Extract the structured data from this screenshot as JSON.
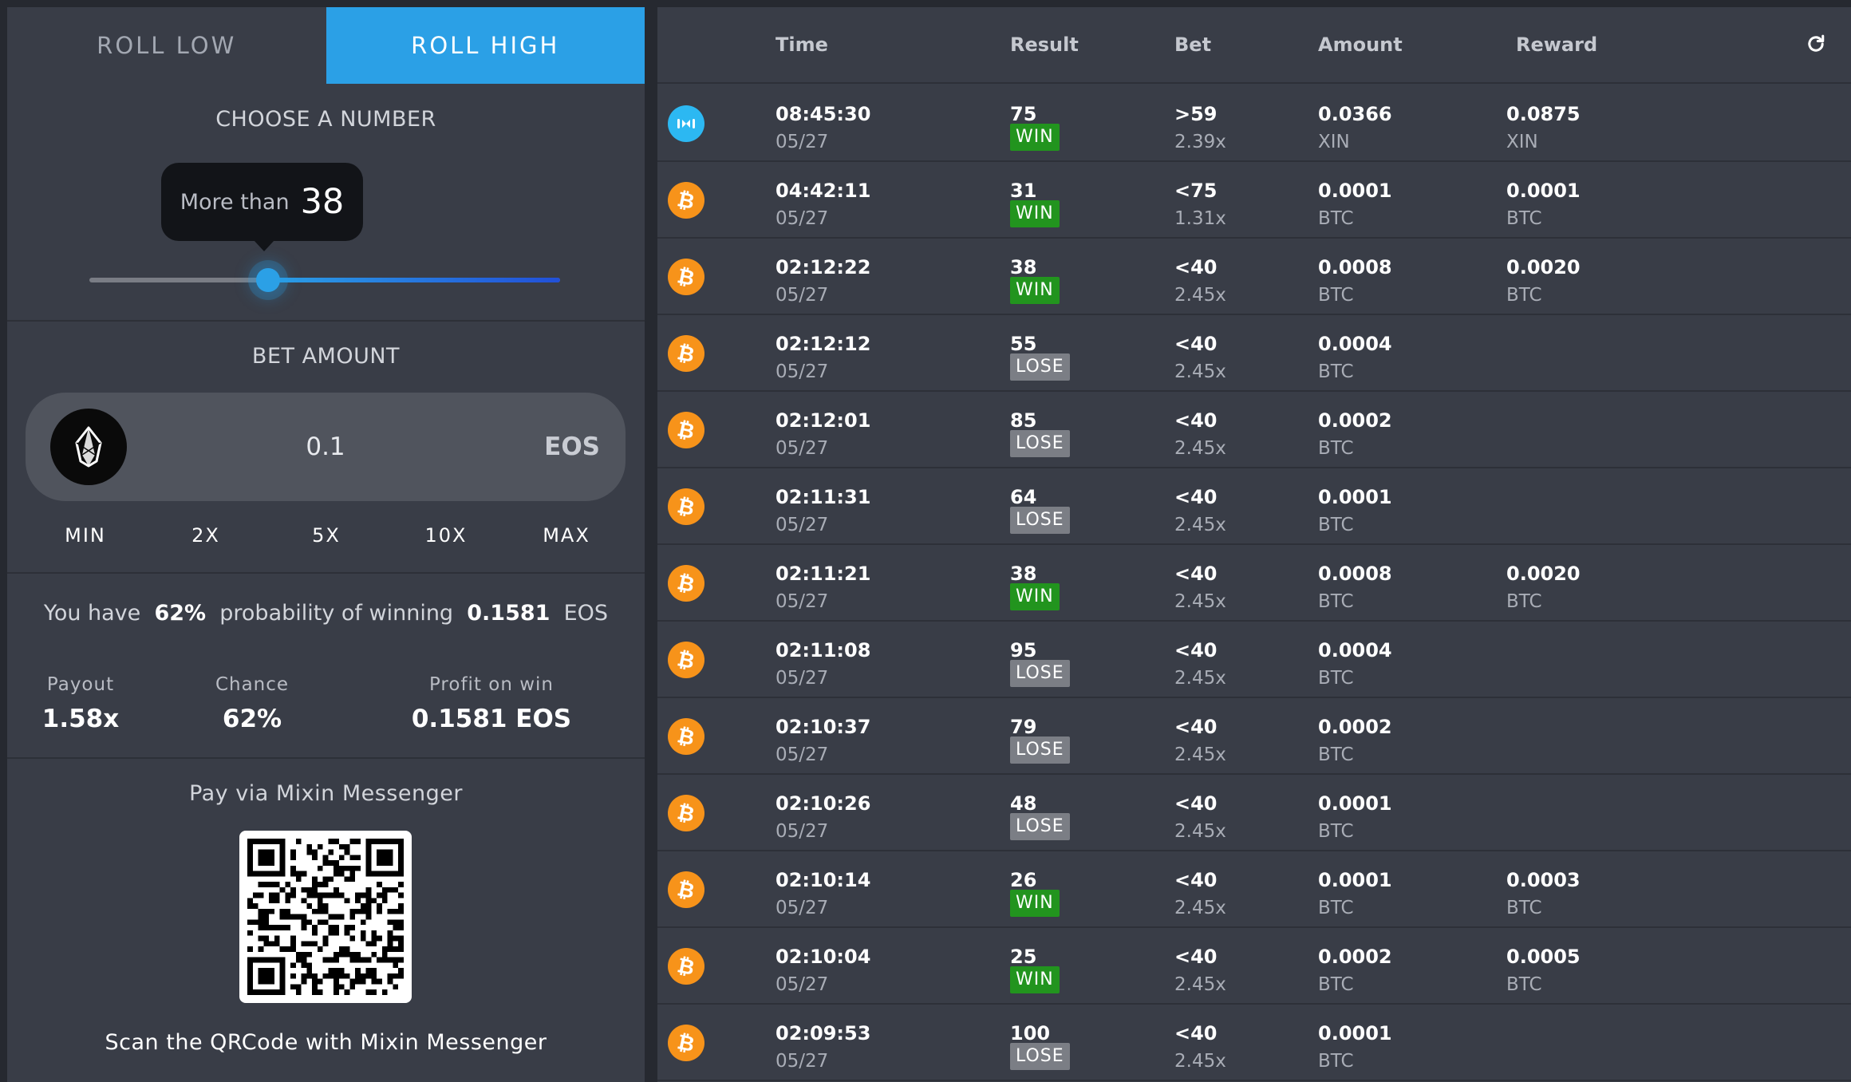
{
  "tabs": [
    {
      "label": "ROLL LOW",
      "active": false
    },
    {
      "label": "ROLL HIGH",
      "active": true
    }
  ],
  "chooser": {
    "heading": "CHOOSE A NUMBER",
    "tooltip_label": "More than",
    "tooltip_value": "38",
    "slider_value": 38,
    "slider_min": 0,
    "slider_max": 100
  },
  "bet": {
    "heading": "BET AMOUNT",
    "coin_icon": "eos-icon",
    "amount": "0.1",
    "currency": "EOS",
    "multipliers": [
      "MIN",
      "2X",
      "5X",
      "10X",
      "MAX"
    ]
  },
  "probability": {
    "prefix": "You have",
    "percent": "62%",
    "middle": "probability of winning",
    "amount": "0.1581",
    "currency": "EOS"
  },
  "stats": {
    "payout_label": "Payout",
    "payout_value": "1.58x",
    "chance_label": "Chance",
    "chance_value": "62%",
    "profit_label": "Profit on win",
    "profit_value": "0.1581 EOS"
  },
  "pay": {
    "heading": "Pay via Mixin Messenger",
    "footer": "Scan the QRCode with Mixin Messenger"
  },
  "table": {
    "headers": [
      "Time",
      "Result",
      "Bet",
      "Amount",
      "Reward"
    ],
    "refresh_icon": "refresh-icon",
    "rows": [
      {
        "icon": "xin",
        "time": "08:45:30",
        "date": "05/27",
        "result": "75",
        "outcome": "WIN",
        "bet": ">59",
        "mult": "2.39x",
        "amount": "0.0366",
        "amount_cur": "XIN",
        "reward": "0.0875",
        "reward_cur": "XIN"
      },
      {
        "icon": "btc",
        "time": "04:42:11",
        "date": "05/27",
        "result": "31",
        "outcome": "WIN",
        "bet": "<75",
        "mult": "1.31x",
        "amount": "0.0001",
        "amount_cur": "BTC",
        "reward": "0.0001",
        "reward_cur": "BTC"
      },
      {
        "icon": "btc",
        "time": "02:12:22",
        "date": "05/27",
        "result": "38",
        "outcome": "WIN",
        "bet": "<40",
        "mult": "2.45x",
        "amount": "0.0008",
        "amount_cur": "BTC",
        "reward": "0.0020",
        "reward_cur": "BTC"
      },
      {
        "icon": "btc",
        "time": "02:12:12",
        "date": "05/27",
        "result": "55",
        "outcome": "LOSE",
        "bet": "<40",
        "mult": "2.45x",
        "amount": "0.0004",
        "amount_cur": "BTC",
        "reward": "",
        "reward_cur": ""
      },
      {
        "icon": "btc",
        "time": "02:12:01",
        "date": "05/27",
        "result": "85",
        "outcome": "LOSE",
        "bet": "<40",
        "mult": "2.45x",
        "amount": "0.0002",
        "amount_cur": "BTC",
        "reward": "",
        "reward_cur": ""
      },
      {
        "icon": "btc",
        "time": "02:11:31",
        "date": "05/27",
        "result": "64",
        "outcome": "LOSE",
        "bet": "<40",
        "mult": "2.45x",
        "amount": "0.0001",
        "amount_cur": "BTC",
        "reward": "",
        "reward_cur": ""
      },
      {
        "icon": "btc",
        "time": "02:11:21",
        "date": "05/27",
        "result": "38",
        "outcome": "WIN",
        "bet": "<40",
        "mult": "2.45x",
        "amount": "0.0008",
        "amount_cur": "BTC",
        "reward": "0.0020",
        "reward_cur": "BTC"
      },
      {
        "icon": "btc",
        "time": "02:11:08",
        "date": "05/27",
        "result": "95",
        "outcome": "LOSE",
        "bet": "<40",
        "mult": "2.45x",
        "amount": "0.0004",
        "amount_cur": "BTC",
        "reward": "",
        "reward_cur": ""
      },
      {
        "icon": "btc",
        "time": "02:10:37",
        "date": "05/27",
        "result": "79",
        "outcome": "LOSE",
        "bet": "<40",
        "mult": "2.45x",
        "amount": "0.0002",
        "amount_cur": "BTC",
        "reward": "",
        "reward_cur": ""
      },
      {
        "icon": "btc",
        "time": "02:10:26",
        "date": "05/27",
        "result": "48",
        "outcome": "LOSE",
        "bet": "<40",
        "mult": "2.45x",
        "amount": "0.0001",
        "amount_cur": "BTC",
        "reward": "",
        "reward_cur": ""
      },
      {
        "icon": "btc",
        "time": "02:10:14",
        "date": "05/27",
        "result": "26",
        "outcome": "WIN",
        "bet": "<40",
        "mult": "2.45x",
        "amount": "0.0001",
        "amount_cur": "BTC",
        "reward": "0.0003",
        "reward_cur": "BTC"
      },
      {
        "icon": "btc",
        "time": "02:10:04",
        "date": "05/27",
        "result": "25",
        "outcome": "WIN",
        "bet": "<40",
        "mult": "2.45x",
        "amount": "0.0002",
        "amount_cur": "BTC",
        "reward": "0.0005",
        "reward_cur": "BTC"
      },
      {
        "icon": "btc",
        "time": "02:09:53",
        "date": "05/27",
        "result": "100",
        "outcome": "LOSE",
        "bet": "<40",
        "mult": "2.45x",
        "amount": "0.0001",
        "amount_cur": "BTC",
        "reward": "",
        "reward_cur": ""
      }
    ]
  },
  "colors": {
    "accent": "#2ba0e6",
    "win": "#22941e",
    "lose": "#7b7e85",
    "btc": "#f7931a",
    "xin": "#2cb8f2"
  }
}
